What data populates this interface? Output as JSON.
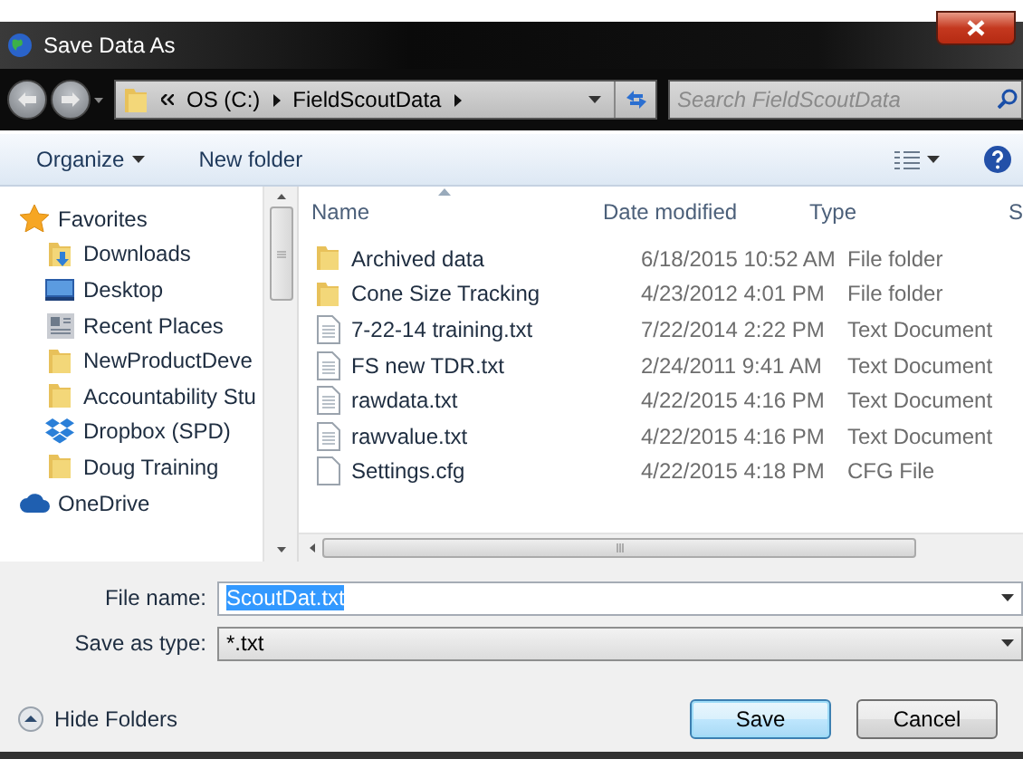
{
  "window": {
    "title": "Save Data As"
  },
  "address_bar": {
    "path": [
      "OS (C:)",
      "FieldScoutData"
    ]
  },
  "search": {
    "placeholder": "Search FieldScoutData"
  },
  "toolbar": {
    "buttons": [
      {
        "label": "Organize",
        "dropdown": true
      },
      {
        "label": "New folder",
        "dropdown": false
      }
    ]
  },
  "sidebar": {
    "items": [
      {
        "label": "Favorites",
        "kind": "star",
        "children": [
          {
            "label": "Downloads",
            "kind": "downloads"
          },
          {
            "label": "Desktop",
            "kind": "desktop"
          },
          {
            "label": "Recent Places",
            "kind": "recent"
          },
          {
            "label": "NewProductDeve",
            "kind": "folder"
          },
          {
            "label": "Accountability Stu",
            "kind": "folder"
          },
          {
            "label": "Dropbox (SPD)",
            "kind": "dropbox"
          },
          {
            "label": "Doug Training",
            "kind": "folder"
          }
        ]
      },
      {
        "label": "OneDrive",
        "kind": "cloud"
      }
    ]
  },
  "file_list": {
    "columns": [
      "Name",
      "Date modified",
      "Type",
      "S"
    ],
    "rows": [
      {
        "kind": "folder",
        "name": "Archived data",
        "date": "6/18/2015 10:52 AM",
        "type": "File folder"
      },
      {
        "kind": "folder",
        "name": "Cone Size Tracking",
        "date": "4/23/2012 4:01 PM",
        "type": "File folder"
      },
      {
        "kind": "text",
        "name": "7-22-14 training.txt",
        "date": "7/22/2014 2:22 PM",
        "type": "Text Document"
      },
      {
        "kind": "text",
        "name": "FS new TDR.txt",
        "date": "2/24/2011 9:41 AM",
        "type": "Text Document"
      },
      {
        "kind": "text",
        "name": "rawdata.txt",
        "date": "4/22/2015 4:16 PM",
        "type": "Text Document"
      },
      {
        "kind": "text",
        "name": "rawvalue.txt",
        "date": "4/22/2015 4:16 PM",
        "type": "Text Document"
      },
      {
        "kind": "file",
        "name": "Settings.cfg",
        "date": "4/22/2015 4:18 PM",
        "type": "CFG File"
      }
    ]
  },
  "footer": {
    "file_name": {
      "label": "File name:",
      "value": "ScoutDat.txt",
      "selected": true
    },
    "save_as_type": {
      "label": "Save as type:",
      "value": "*.txt"
    },
    "hide_folders": "Hide Folders",
    "buttons": [
      "Save",
      "Cancel"
    ]
  }
}
